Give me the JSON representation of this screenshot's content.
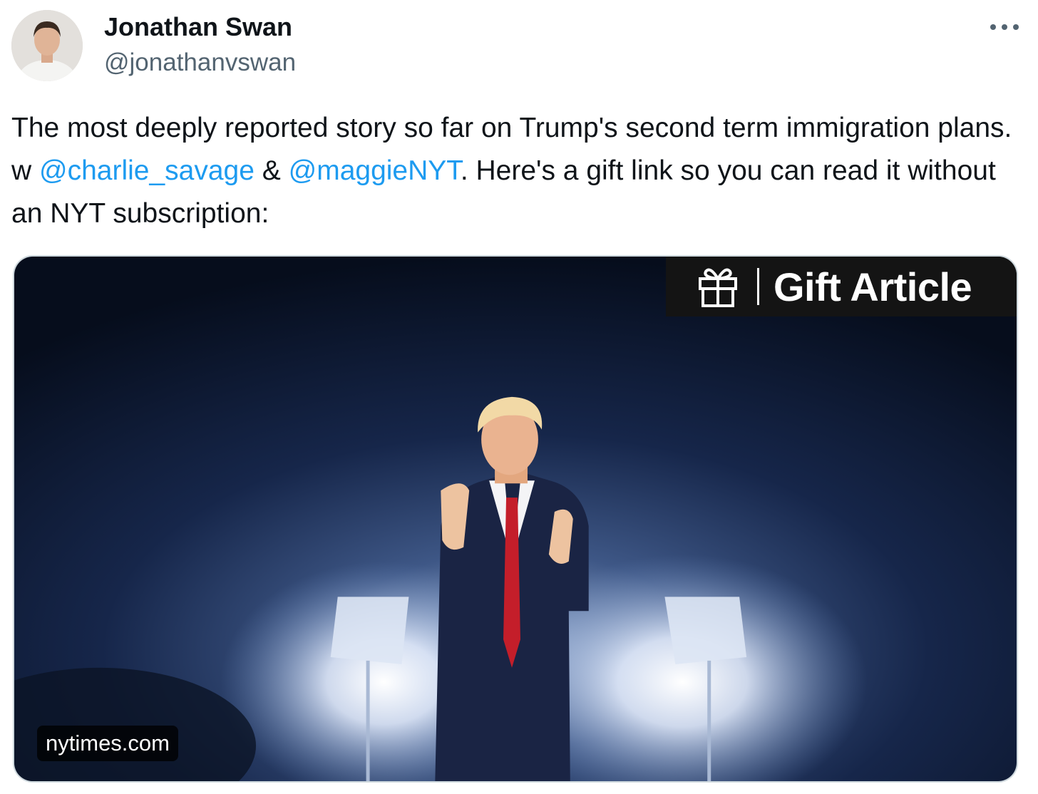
{
  "author": {
    "name": "Jonathan Swan",
    "handle": "@jonathanvswan"
  },
  "more_icon": "more-horizontal-icon",
  "tweet": {
    "text_part1": "The most deeply reported story so far on Trump's second term immigration plans. w ",
    "mention1": "@charlie_savage",
    "text_part2": " & ",
    "mention2": "@maggieNYT",
    "text_part3": ". Here's a gift link so you can read it without an NYT subscription:"
  },
  "card": {
    "banner_icon": "gift-icon",
    "banner_label": "Gift Article",
    "domain": "nytimes.com"
  },
  "colors": {
    "text": "#0f1419",
    "secondary": "#536471",
    "link": "#1d9bf0"
  }
}
